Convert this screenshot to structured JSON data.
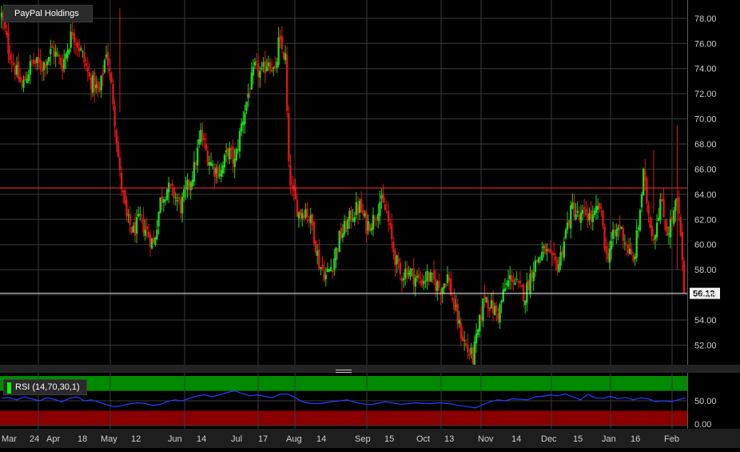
{
  "title": "PayPal Holdings",
  "last_price_label": "56.12",
  "colors": {
    "up": "#1fd41f",
    "down": "#e01414",
    "grid": "#3a3a3a",
    "hline_red": "#ff3030",
    "rsi_line": "#2a3cff",
    "rsi_overbought": "#008a00",
    "rsi_oversold": "#8a0000"
  },
  "chart_data": [
    {
      "type": "candlestick",
      "title": "PayPal Holdings",
      "y_ticks": [
        "78.00",
        "76.00",
        "74.00",
        "72.00",
        "70.00",
        "68.00",
        "66.00",
        "64.00",
        "62.00",
        "60.00",
        "58.00",
        "56.00",
        "54.00",
        "52.00"
      ],
      "ylim": [
        50.5,
        79.2
      ],
      "x_labels": [
        "Mar",
        "24",
        "Apr",
        "18",
        "May",
        "12",
        "Jun",
        "14",
        "Jul",
        "17",
        "Aug",
        "14",
        "Sep",
        "15",
        "Oct",
        "13",
        "Nov",
        "14",
        "Dec",
        "15",
        "Jan",
        "16",
        "Feb"
      ],
      "horizontal_line": 64.5,
      "last_price": 56.12,
      "grid": true,
      "close_path": [
        {
          "i": 0,
          "v": 78.2
        },
        {
          "i": 4,
          "v": 75.6
        },
        {
          "i": 8,
          "v": 74.0
        },
        {
          "i": 12,
          "v": 72.5
        },
        {
          "i": 18,
          "v": 74.5
        },
        {
          "i": 24,
          "v": 74.2
        },
        {
          "i": 30,
          "v": 75.5
        },
        {
          "i": 36,
          "v": 74.3
        },
        {
          "i": 42,
          "v": 77.0
        },
        {
          "i": 48,
          "v": 75.0
        },
        {
          "i": 52,
          "v": 73.2
        },
        {
          "i": 58,
          "v": 72.0
        },
        {
          "i": 62,
          "v": 75.5
        },
        {
          "i": 66,
          "v": 71.5
        },
        {
          "i": 70,
          "v": 65.5
        },
        {
          "i": 74,
          "v": 62.0
        },
        {
          "i": 78,
          "v": 61.0
        },
        {
          "i": 82,
          "v": 62.0
        },
        {
          "i": 86,
          "v": 61.0
        },
        {
          "i": 90,
          "v": 60.0
        },
        {
          "i": 94,
          "v": 63.5
        },
        {
          "i": 98,
          "v": 64.5
        },
        {
          "i": 102,
          "v": 64.0
        },
        {
          "i": 106,
          "v": 63.0
        },
        {
          "i": 110,
          "v": 64.5
        },
        {
          "i": 114,
          "v": 66.0
        },
        {
          "i": 118,
          "v": 68.8
        },
        {
          "i": 122,
          "v": 67.0
        },
        {
          "i": 126,
          "v": 66.0
        },
        {
          "i": 130,
          "v": 65.8
        },
        {
          "i": 134,
          "v": 67.5
        },
        {
          "i": 138,
          "v": 66.5
        },
        {
          "i": 142,
          "v": 69.5
        },
        {
          "i": 146,
          "v": 72.0
        },
        {
          "i": 150,
          "v": 74.0
        },
        {
          "i": 154,
          "v": 73.5
        },
        {
          "i": 158,
          "v": 74.8
        },
        {
          "i": 162,
          "v": 73.5
        },
        {
          "i": 164,
          "v": 76.0
        },
        {
          "i": 166,
          "v": 75.5
        },
        {
          "i": 168,
          "v": 74.8
        },
        {
          "i": 170,
          "v": 66.0
        },
        {
          "i": 172,
          "v": 64.2
        },
        {
          "i": 176,
          "v": 62.5
        },
        {
          "i": 180,
          "v": 62.8
        },
        {
          "i": 184,
          "v": 61.5
        },
        {
          "i": 188,
          "v": 58.5
        },
        {
          "i": 192,
          "v": 57.5
        },
        {
          "i": 196,
          "v": 58.5
        },
        {
          "i": 200,
          "v": 60.5
        },
        {
          "i": 204,
          "v": 61.5
        },
        {
          "i": 208,
          "v": 62.5
        },
        {
          "i": 212,
          "v": 63.0
        },
        {
          "i": 216,
          "v": 61.5
        },
        {
          "i": 220,
          "v": 62.0
        },
        {
          "i": 224,
          "v": 63.5
        },
        {
          "i": 228,
          "v": 62.5
        },
        {
          "i": 232,
          "v": 59.5
        },
        {
          "i": 236,
          "v": 57.5
        },
        {
          "i": 240,
          "v": 58.0
        },
        {
          "i": 244,
          "v": 57.5
        },
        {
          "i": 248,
          "v": 57.0
        },
        {
          "i": 252,
          "v": 57.5
        },
        {
          "i": 256,
          "v": 57.0
        },
        {
          "i": 260,
          "v": 56.5
        },
        {
          "i": 264,
          "v": 57.5
        },
        {
          "i": 268,
          "v": 55.0
        },
        {
          "i": 272,
          "v": 53.0
        },
        {
          "i": 276,
          "v": 51.5
        },
        {
          "i": 279,
          "v": 51.0
        },
        {
          "i": 282,
          "v": 53.0
        },
        {
          "i": 286,
          "v": 56.0
        },
        {
          "i": 290,
          "v": 55.0
        },
        {
          "i": 294,
          "v": 54.5
        },
        {
          "i": 298,
          "v": 56.5
        },
        {
          "i": 302,
          "v": 57.5
        },
        {
          "i": 306,
          "v": 56.5
        },
        {
          "i": 310,
          "v": 56.0
        },
        {
          "i": 314,
          "v": 58.0
        },
        {
          "i": 318,
          "v": 59.0
        },
        {
          "i": 322,
          "v": 59.5
        },
        {
          "i": 326,
          "v": 58.5
        },
        {
          "i": 330,
          "v": 58.5
        },
        {
          "i": 334,
          "v": 61.0
        },
        {
          "i": 338,
          "v": 63.0
        },
        {
          "i": 342,
          "v": 62.0
        },
        {
          "i": 346,
          "v": 62.5
        },
        {
          "i": 350,
          "v": 62.0
        },
        {
          "i": 354,
          "v": 63.0
        },
        {
          "i": 356,
          "v": 61.5
        },
        {
          "i": 358,
          "v": 59.0
        },
        {
          "i": 362,
          "v": 60.5
        },
        {
          "i": 366,
          "v": 61.5
        },
        {
          "i": 370,
          "v": 60.0
        },
        {
          "i": 374,
          "v": 58.5
        },
        {
          "i": 377,
          "v": 61.5
        },
        {
          "i": 380,
          "v": 65.5
        },
        {
          "i": 383,
          "v": 62.5
        },
        {
          "i": 386,
          "v": 60.5
        },
        {
          "i": 390,
          "v": 63.5
        },
        {
          "i": 394,
          "v": 61.0
        },
        {
          "i": 397,
          "v": 62.0
        },
        {
          "i": 400,
          "v": 63.5
        },
        {
          "i": 402,
          "v": 60.5
        },
        {
          "i": 404,
          "v": 56.12
        }
      ],
      "n_bars": 405,
      "price_range": [
        50.5,
        79.2
      ]
    },
    {
      "type": "line",
      "title": "RSI (14,70,30,1)",
      "y_ticks": [
        "50.00",
        "0.00"
      ],
      "ylim": [
        0,
        100
      ],
      "overbought": 70,
      "oversold": 30,
      "series": [
        {
          "name": "RSI (14,70,30,1)",
          "values": [
            55,
            57,
            52,
            58,
            54,
            50,
            56,
            53,
            48,
            55,
            58,
            50,
            52,
            47,
            42,
            38,
            40,
            44,
            46,
            45,
            41,
            42,
            48,
            52,
            50,
            55,
            60,
            62,
            58,
            62,
            67,
            70,
            65,
            60,
            62,
            59,
            56,
            63,
            64,
            57,
            48,
            45,
            44,
            46,
            48,
            50,
            52,
            47,
            44,
            42,
            45,
            48,
            46,
            43,
            44,
            46,
            45,
            44,
            46,
            45,
            43,
            40,
            38,
            36,
            42,
            48,
            52,
            50,
            54,
            53,
            52,
            58,
            59,
            62,
            60,
            64,
            58,
            52,
            63,
            56,
            55,
            59,
            54,
            57,
            52,
            56,
            54,
            48,
            50,
            48,
            52,
            56
          ]
        }
      ]
    }
  ]
}
